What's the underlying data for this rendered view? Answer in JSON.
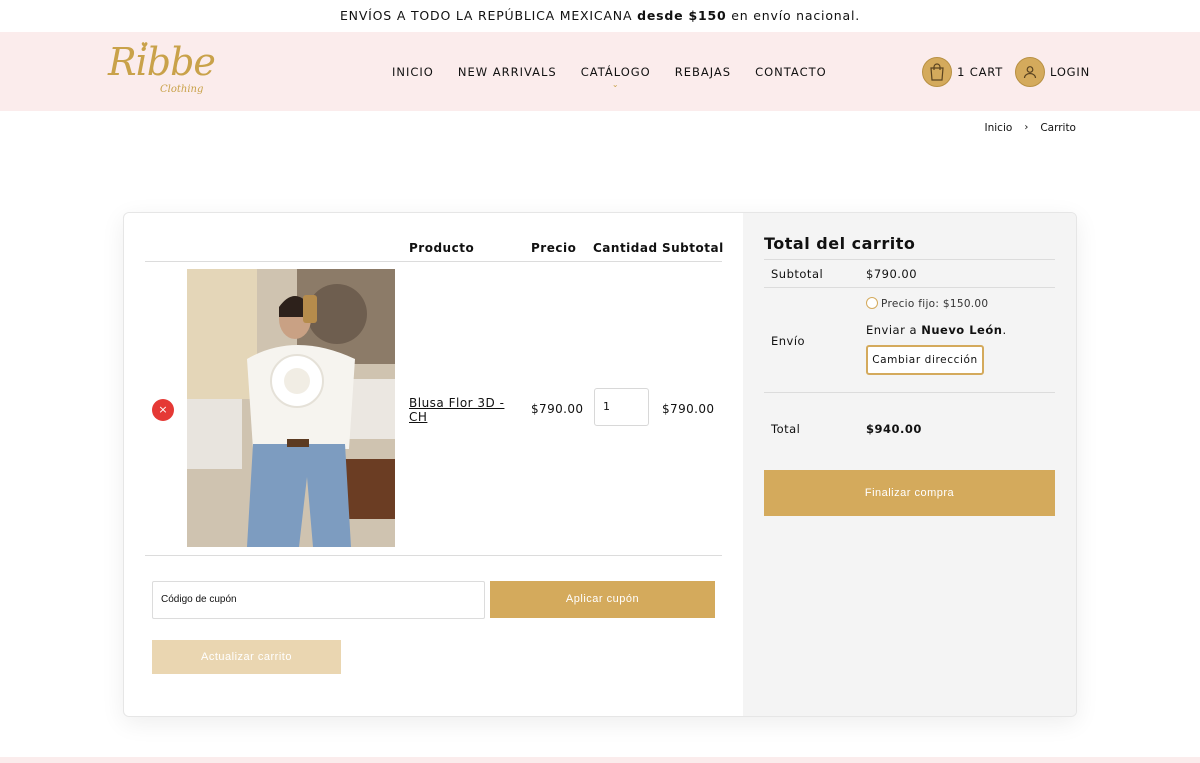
{
  "announcement": {
    "before": "ENVÍOS A TODO LA REPÚBLICA MEXICANA",
    "bold": "desde $150",
    "after": "en envío nacional."
  },
  "brand": {
    "logo_text": "Ribbe",
    "logo_sub": "Clothing"
  },
  "nav": {
    "items": [
      "INICIO",
      "NEW ARRIVALS",
      "CATÁLOGO",
      "REBAJAS",
      "CONTACTO"
    ]
  },
  "header": {
    "cart_label": "1 CART",
    "login_label": "LOGIN"
  },
  "breadcrumb": {
    "items": [
      "Inicio",
      "Carrito"
    ],
    "separator": "›"
  },
  "cart": {
    "columns": {
      "product": "Producto",
      "price": "Precio",
      "quantity": "Cantidad",
      "subtotal": "Subtotal"
    },
    "items": [
      {
        "remove_label": "×",
        "name": "Blusa Flor 3D - CH",
        "price": "$790.00",
        "quantity": "1",
        "subtotal": "$790.00"
      }
    ],
    "coupon_placeholder": "Código de cupón",
    "apply_coupon": "Aplicar cupón",
    "update_cart": "Actualizar carrito"
  },
  "totals": {
    "title": "Total del carrito",
    "subtotal_label": "Subtotal",
    "subtotal_value": "$790.00",
    "shipping_label": "Envío",
    "shipping_option": "Precio fijo: $150.00",
    "ship_to_prefix": "Enviar a",
    "ship_to_place": "Nuevo León",
    "ship_to_suffix": ".",
    "change_address": "Cambiar dirección",
    "total_label": "Total",
    "total_value": "$940.00",
    "checkout": "Finalizar compra"
  },
  "colors": {
    "accent": "#d4aa5c",
    "header_bg": "#fbecec",
    "remove": "#e53935",
    "panel_bg": "#f4f4f4"
  }
}
